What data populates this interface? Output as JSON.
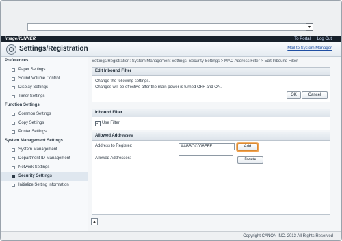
{
  "browser": {
    "address_value": "",
    "dropdown_icon": "▾"
  },
  "topbar": {
    "brand": "imageRUNNER",
    "links": [
      "To Portal",
      "Log Out"
    ]
  },
  "header": {
    "title": "Settings/Registration",
    "mail_link": "Mail to System Manager"
  },
  "sidebar": {
    "sections": [
      {
        "title": "Preferences",
        "items": [
          "Paper Settings",
          "Sound Volume Control",
          "Display Settings",
          "Timer Settings"
        ]
      },
      {
        "title": "Function Settings",
        "items": [
          "Common Settings",
          "Copy Settings",
          "Printer Settings"
        ]
      },
      {
        "title": "System Management Settings",
        "items": [
          "System Management",
          "Department ID Management",
          "Network Settings",
          "Security Settings",
          "Initialize Setting Information"
        ]
      }
    ]
  },
  "main": {
    "breadcrumb": "Settings/Registration: System Management Settings: Security Settings > MAC Address Filter > Edit Inbound Filter",
    "edit_panel": {
      "title": "Edit Inbound Filter",
      "line1": "Change the following settings.",
      "line2": "Changes will be effective after the main power is turned OFF and ON.",
      "ok": "OK",
      "cancel": "Cancel"
    },
    "inbound_filter": {
      "title": "Inbound Filter",
      "use_filter": "Use Filter",
      "checked": "✓"
    },
    "allowed_addresses": {
      "title": "Allowed Addresses",
      "register_label": "Address to Register:",
      "register_value": "AABBCC006EFF",
      "add": "Add",
      "allowed_label": "Allowed Addresses:",
      "delete": "Delete"
    },
    "up_icon": "▲",
    "copyright": "Copyright CANON INC. 2013 All Rights Reserved"
  }
}
